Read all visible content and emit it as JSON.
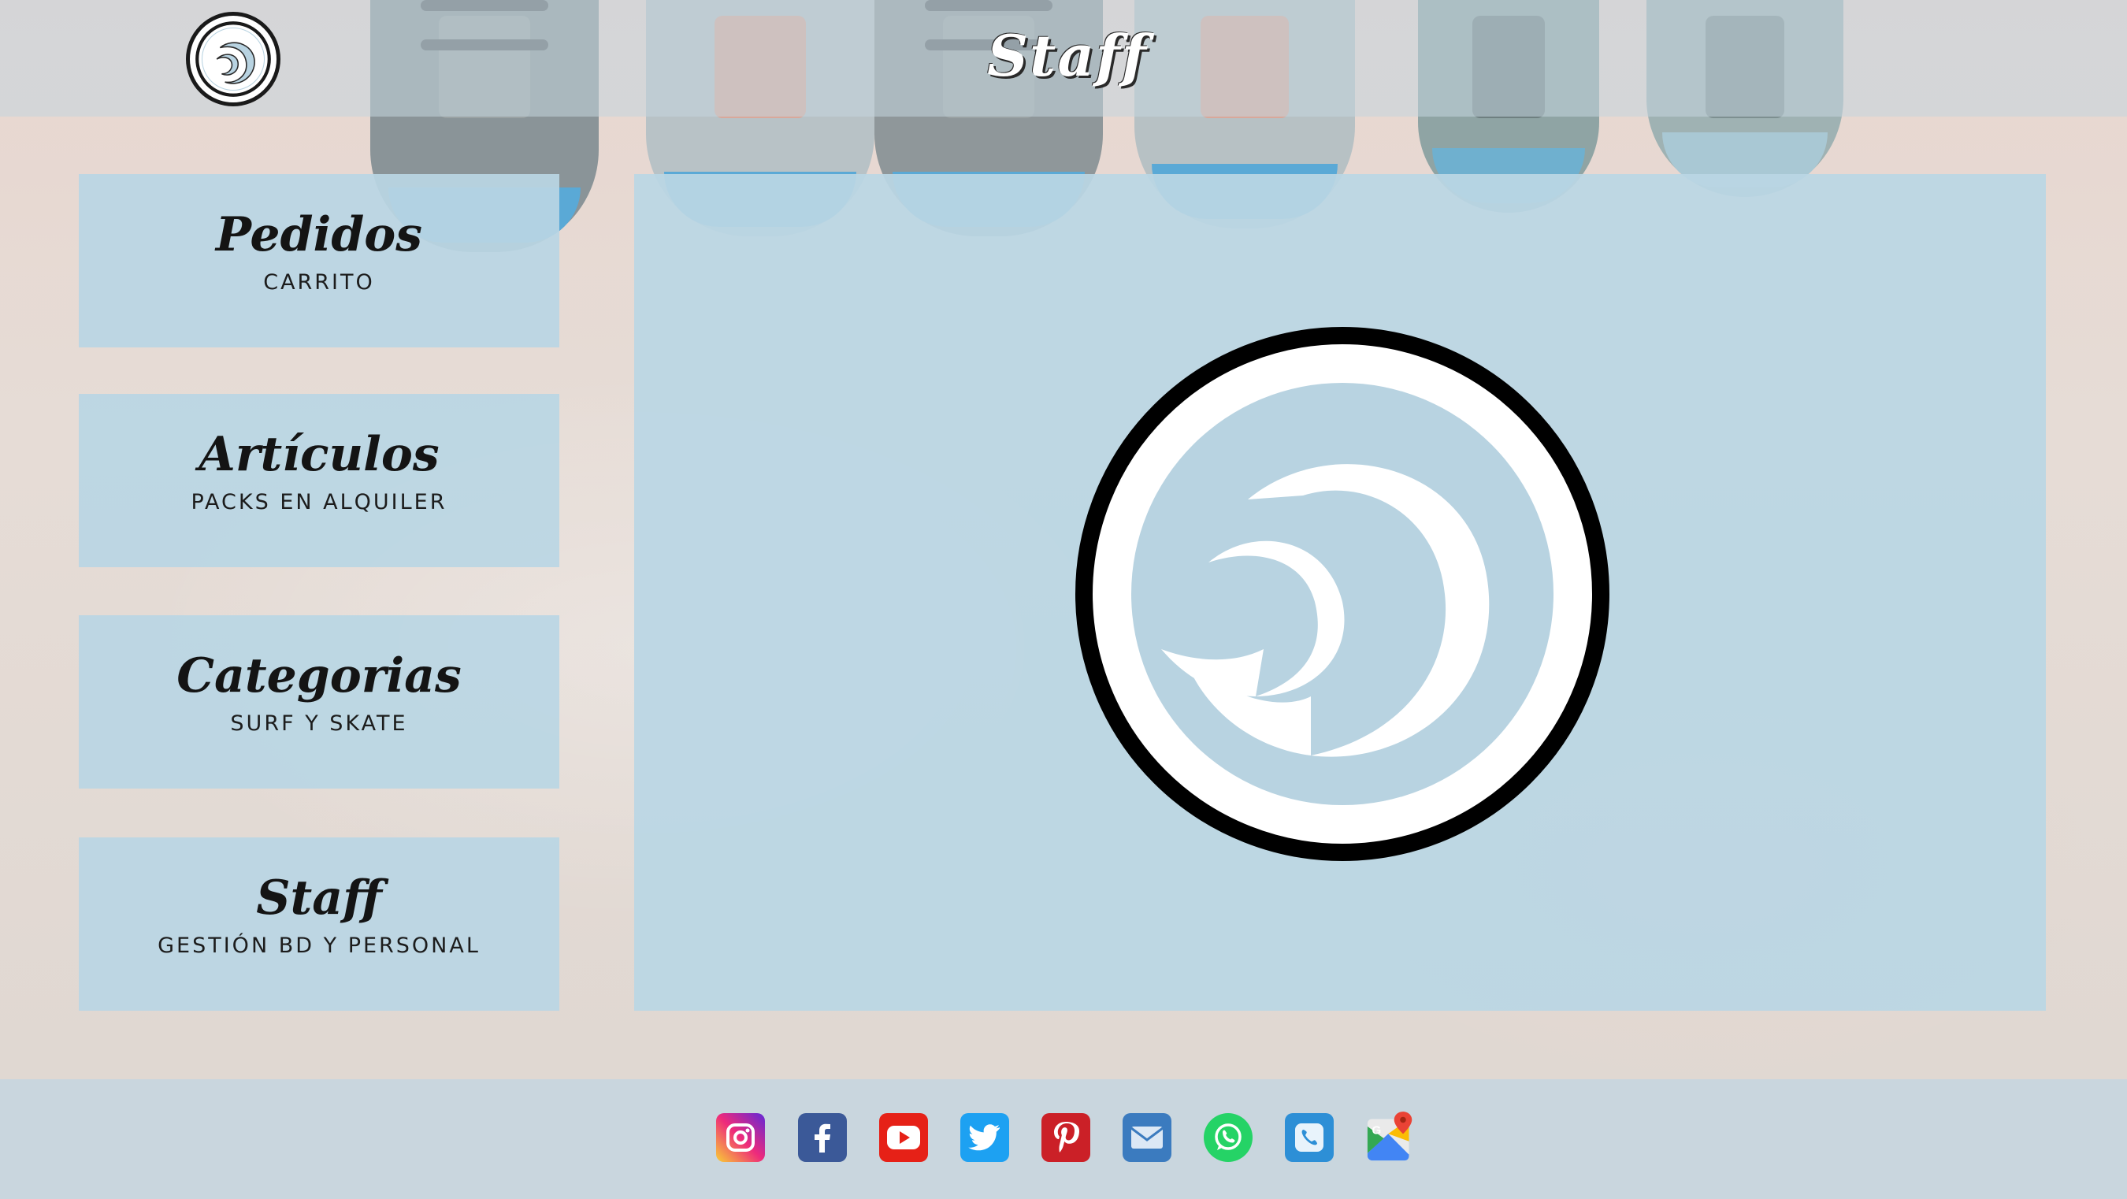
{
  "header": {
    "title": "Staff",
    "logo_icon": "wave-logo-icon"
  },
  "menu": [
    {
      "title": "Pedidos",
      "subtitle": "CARRITO"
    },
    {
      "title": "Artículos",
      "subtitle": "PACKS EN ALQUILER"
    },
    {
      "title": "Categorias",
      "subtitle": "SURF Y SKATE"
    },
    {
      "title": "Staff",
      "subtitle": "GESTIÓN BD Y PERSONAL"
    }
  ],
  "main": {
    "logo_icon": "wave-logo-icon"
  },
  "footer": {
    "social": [
      {
        "name": "instagram-icon",
        "color": "#c13584"
      },
      {
        "name": "facebook-icon",
        "color": "#3b5998"
      },
      {
        "name": "youtube-icon",
        "color": "#e62117"
      },
      {
        "name": "twitter-icon",
        "color": "#1da1f2"
      },
      {
        "name": "pinterest-icon",
        "color": "#cb2027"
      },
      {
        "name": "mail-icon",
        "color": "#3b7bbf"
      },
      {
        "name": "whatsapp-icon",
        "color": "#25d366"
      },
      {
        "name": "phone-icon",
        "color": "#2d8fd6"
      },
      {
        "name": "google-maps-icon",
        "color": "#4285f4"
      }
    ]
  }
}
